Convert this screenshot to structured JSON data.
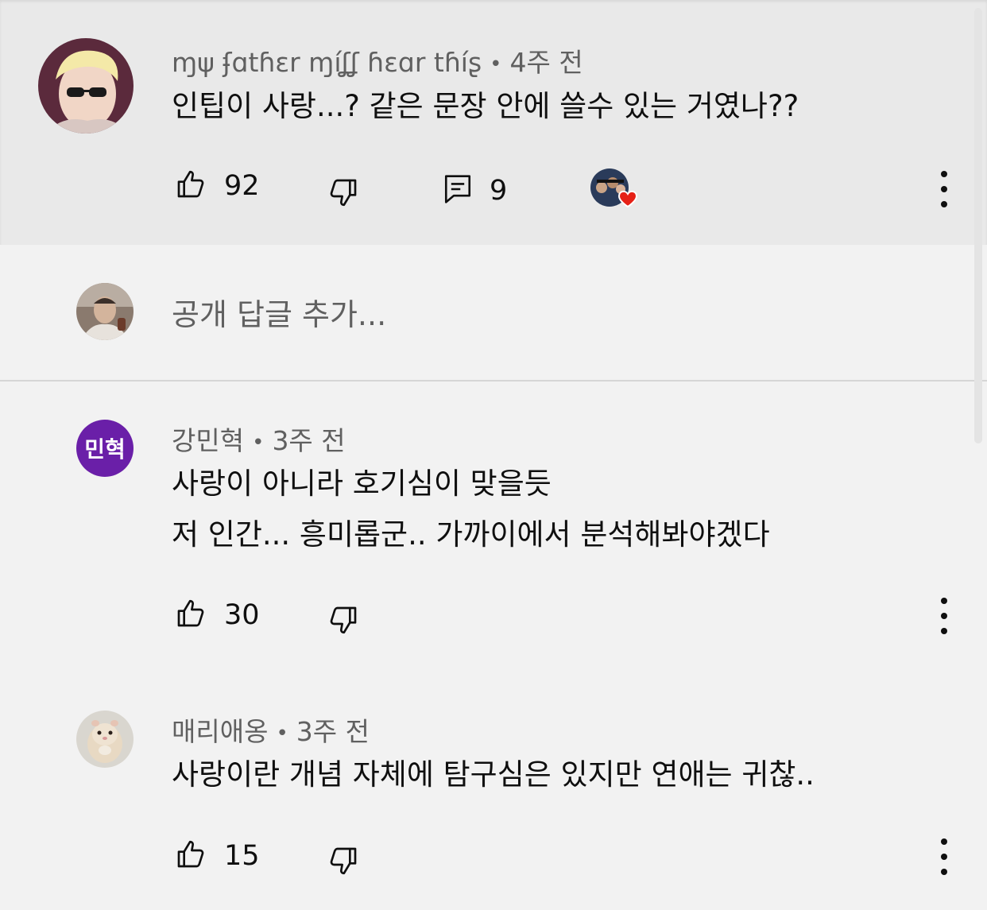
{
  "comments": [
    {
      "author": "ɱψ ʄɑtɦɛr ɱíʆʆ ɦɛɑr tɦíʂ",
      "age": "4주 전",
      "text": "인팁이 사랑...? 같은 문장 안에 쓸수 있는 거였나??",
      "likes": "92",
      "replies": "9",
      "creator_hearted": true
    },
    {
      "author": "강민혁",
      "avatar_initials": "민혁",
      "age": "3주 전",
      "text_lines": [
        "사랑이 아니라 호기심이 맞을듯",
        "저 인간... 흥미롭군.. 가까이에서 분석해봐야겠다"
      ],
      "likes": "30"
    },
    {
      "author": "매리애옹",
      "age": "3주 전",
      "text": "사랑이란 개념 자체에 탐구심은 있지만 연애는 귀찮..",
      "likes": "15"
    }
  ],
  "composer": {
    "placeholder": "공개 답글 추가..."
  },
  "separator": "•",
  "colors": {
    "parent_background": "#e9e9e9",
    "page_background": "#f2f2f2",
    "avatar_purple": "#6a1fa8",
    "heart_red": "#e62117"
  },
  "icons": [
    "thumb-up-icon",
    "thumb-down-icon",
    "reply-icon",
    "creator-heart-icon",
    "more-vert-icon"
  ]
}
